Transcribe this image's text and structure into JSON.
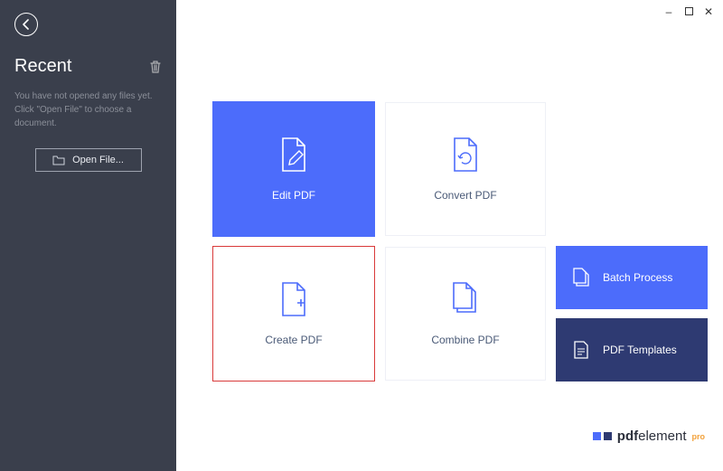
{
  "sidebar": {
    "title": "Recent",
    "hint": "You have not opened any files yet. Click \"Open File\" to choose a document.",
    "open_label": "Open File..."
  },
  "cards": {
    "edit": "Edit PDF",
    "convert": "Convert PDF",
    "create": "Create PDF",
    "combine": "Combine PDF",
    "batch": "Batch Process",
    "templates": "PDF Templates"
  },
  "brand": {
    "name": "pdfelement",
    "suffix": "pro"
  }
}
